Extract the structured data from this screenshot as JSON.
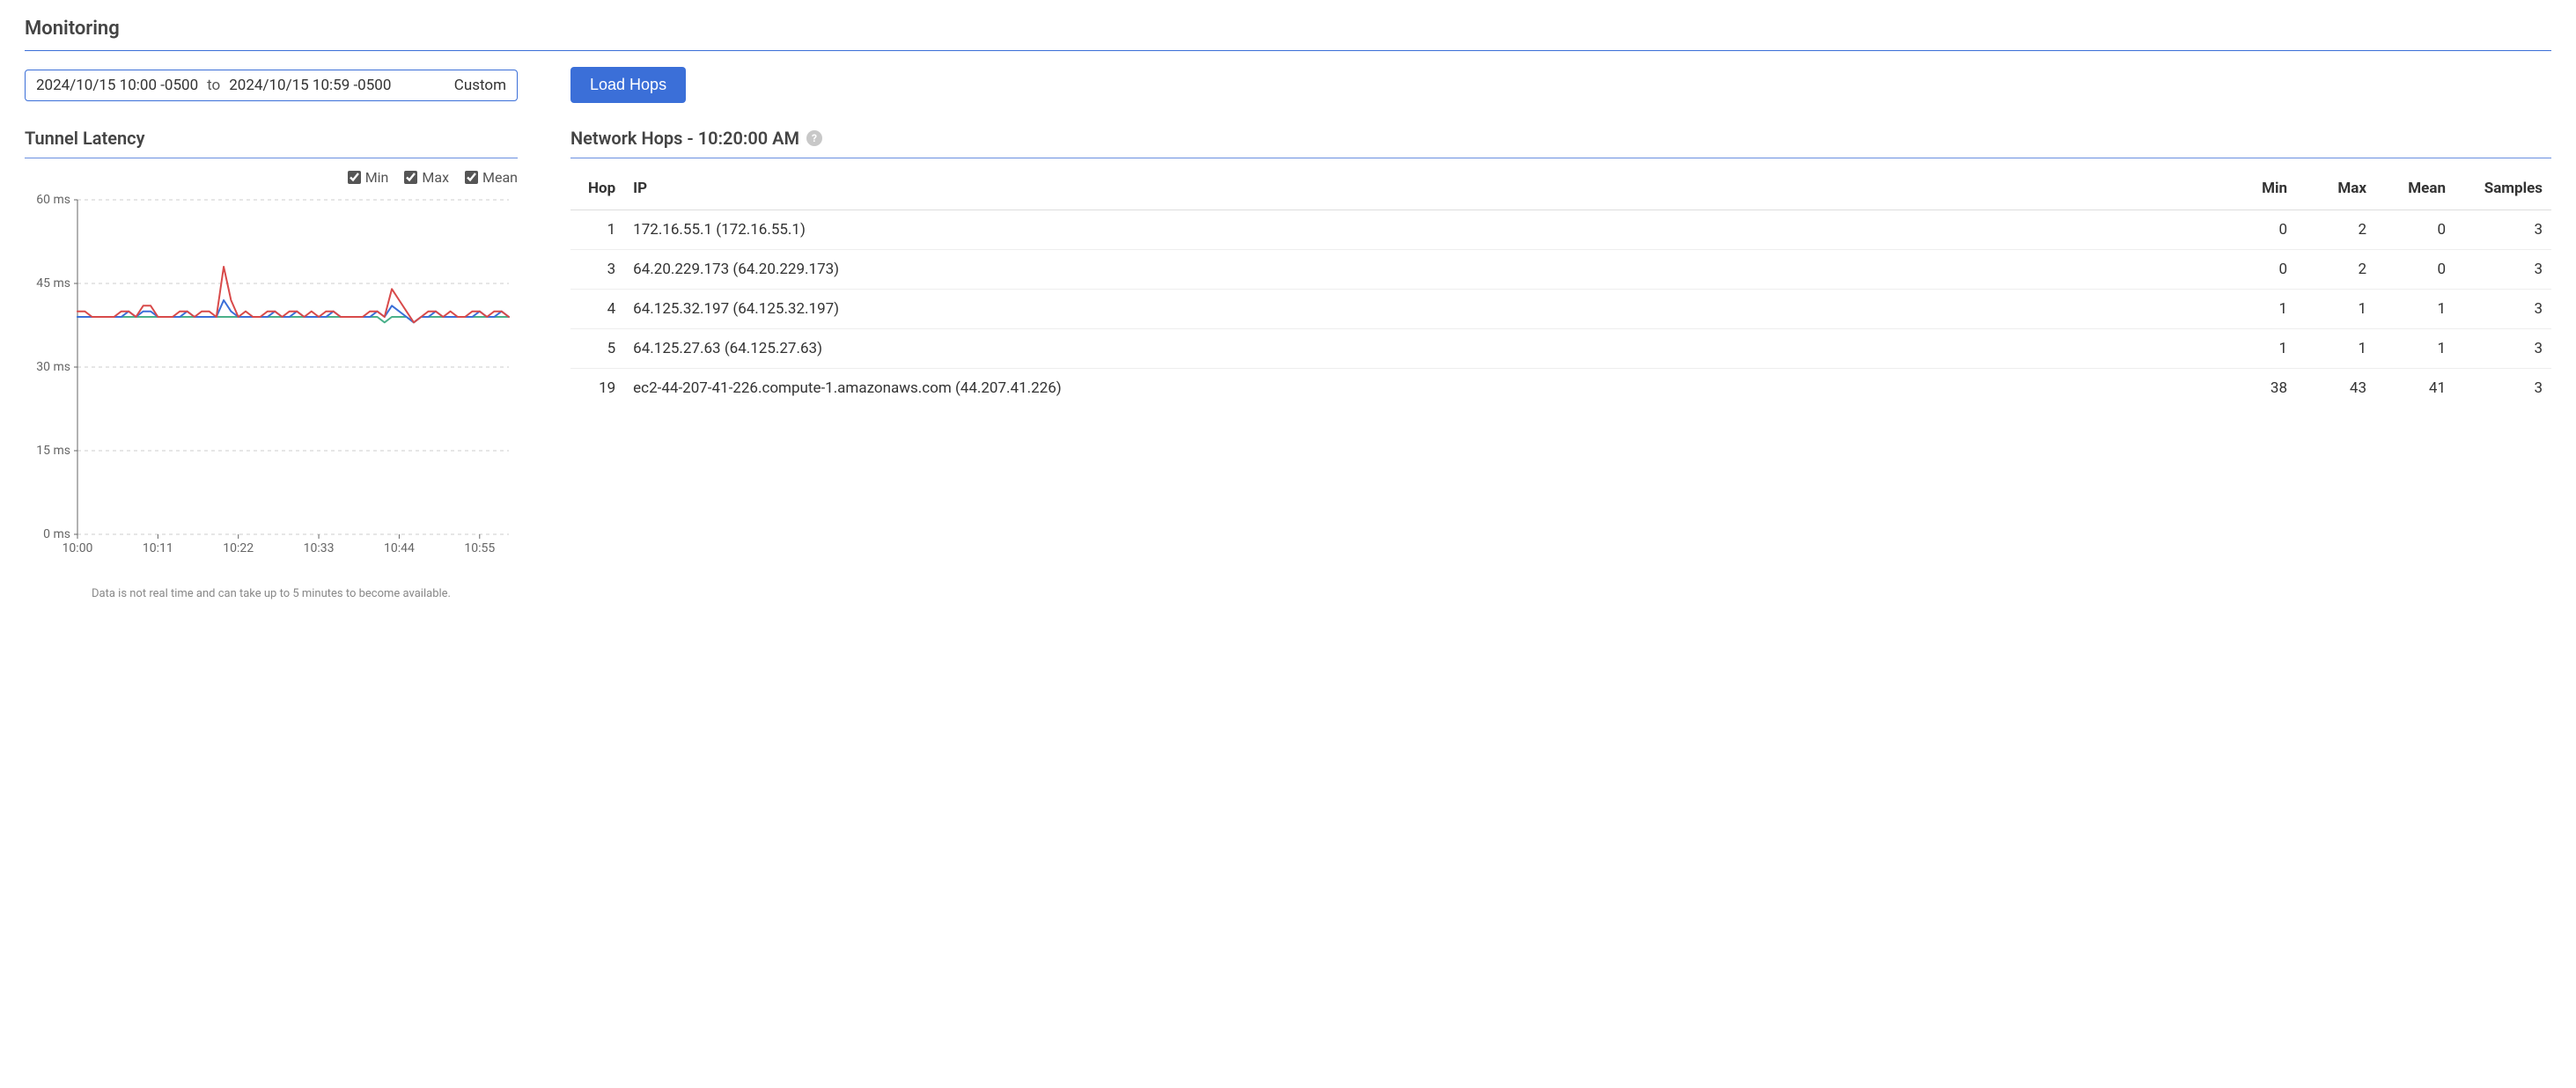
{
  "page_title": "Monitoring",
  "date_range": {
    "from": "2024/10/15 10:00 -0500",
    "sep": "to",
    "to": "2024/10/15 10:59 -0500",
    "mode": "Custom"
  },
  "load_hops_label": "Load Hops",
  "tunnel_latency": {
    "title": "Tunnel Latency",
    "legend": {
      "min": "Min",
      "max": "Max",
      "mean": "Mean"
    },
    "note": "Data is not real time and can take up to 5 minutes to become available."
  },
  "network_hops": {
    "title": "Network Hops - 10:20:00 AM",
    "columns": {
      "hop": "Hop",
      "ip": "IP",
      "min": "Min",
      "max": "Max",
      "mean": "Mean",
      "samples": "Samples"
    },
    "rows": [
      {
        "hop": "1",
        "ip": "172.16.55.1 (172.16.55.1)",
        "min": "0",
        "max": "2",
        "mean": "0",
        "samples": "3"
      },
      {
        "hop": "3",
        "ip": "64.20.229.173 (64.20.229.173)",
        "min": "0",
        "max": "2",
        "mean": "0",
        "samples": "3"
      },
      {
        "hop": "4",
        "ip": "64.125.32.197 (64.125.32.197)",
        "min": "1",
        "max": "1",
        "mean": "1",
        "samples": "3"
      },
      {
        "hop": "5",
        "ip": "64.125.27.63 (64.125.27.63)",
        "min": "1",
        "max": "1",
        "mean": "1",
        "samples": "3"
      },
      {
        "hop": "19",
        "ip": "ec2-44-207-41-226.compute-1.amazonaws.com (44.207.41.226)",
        "min": "38",
        "max": "43",
        "mean": "41",
        "samples": "3"
      }
    ]
  },
  "chart_data": {
    "type": "line",
    "title": "Tunnel Latency",
    "xlabel": "",
    "ylabel": "",
    "x_ticks": [
      "10:00",
      "10:11",
      "10:22",
      "10:33",
      "10:44",
      "10:55"
    ],
    "y_ticks": [
      "0 ms",
      "15 ms",
      "30 ms",
      "45 ms",
      "60 ms"
    ],
    "ylim": [
      0,
      60
    ],
    "x": [
      0,
      1,
      2,
      3,
      4,
      5,
      6,
      7,
      8,
      9,
      10,
      11,
      12,
      13,
      14,
      15,
      16,
      17,
      18,
      19,
      20,
      21,
      22,
      23,
      24,
      25,
      26,
      27,
      28,
      29,
      30,
      31,
      32,
      33,
      34,
      35,
      36,
      37,
      38,
      39,
      40,
      41,
      42,
      43,
      44,
      45,
      46,
      47,
      48,
      49,
      50,
      51,
      52,
      53,
      54,
      55,
      56,
      57,
      58,
      59
    ],
    "series": [
      {
        "name": "Min",
        "color": "#4ab08a",
        "values": [
          39,
          39,
          39,
          39,
          39,
          39,
          39,
          39,
          39,
          39,
          39,
          39,
          39,
          39,
          39,
          39,
          39,
          39,
          39,
          39,
          39,
          39,
          39,
          39,
          39,
          39,
          39,
          39,
          39,
          39,
          39,
          39,
          39,
          39,
          39,
          39,
          39,
          39,
          39,
          39,
          39,
          39,
          38,
          39,
          39,
          39,
          38,
          39,
          39,
          39,
          39,
          39,
          39,
          39,
          39,
          39,
          39,
          39,
          39,
          39
        ]
      },
      {
        "name": "Max",
        "color": "#d84a4a",
        "values": [
          40,
          40,
          39,
          39,
          39,
          39,
          40,
          40,
          39,
          41,
          41,
          39,
          39,
          39,
          40,
          40,
          39,
          40,
          40,
          39,
          48,
          42,
          39,
          40,
          39,
          39,
          40,
          40,
          39,
          40,
          40,
          39,
          40,
          39,
          40,
          40,
          39,
          39,
          39,
          39,
          40,
          40,
          39,
          44,
          42,
          40,
          38,
          39,
          40,
          40,
          39,
          40,
          39,
          39,
          40,
          40,
          39,
          40,
          40,
          39
        ]
      },
      {
        "name": "Mean",
        "color": "#3b6fd8",
        "values": [
          39,
          39,
          39,
          39,
          39,
          39,
          39,
          40,
          39,
          40,
          40,
          39,
          39,
          39,
          39,
          40,
          39,
          39,
          39,
          39,
          42,
          40,
          39,
          39,
          39,
          39,
          39,
          40,
          39,
          39,
          40,
          39,
          39,
          39,
          39,
          40,
          39,
          39,
          39,
          39,
          39,
          40,
          39,
          41,
          40,
          39,
          38,
          39,
          39,
          40,
          39,
          39,
          39,
          39,
          39,
          40,
          39,
          39,
          40,
          39
        ]
      }
    ]
  }
}
